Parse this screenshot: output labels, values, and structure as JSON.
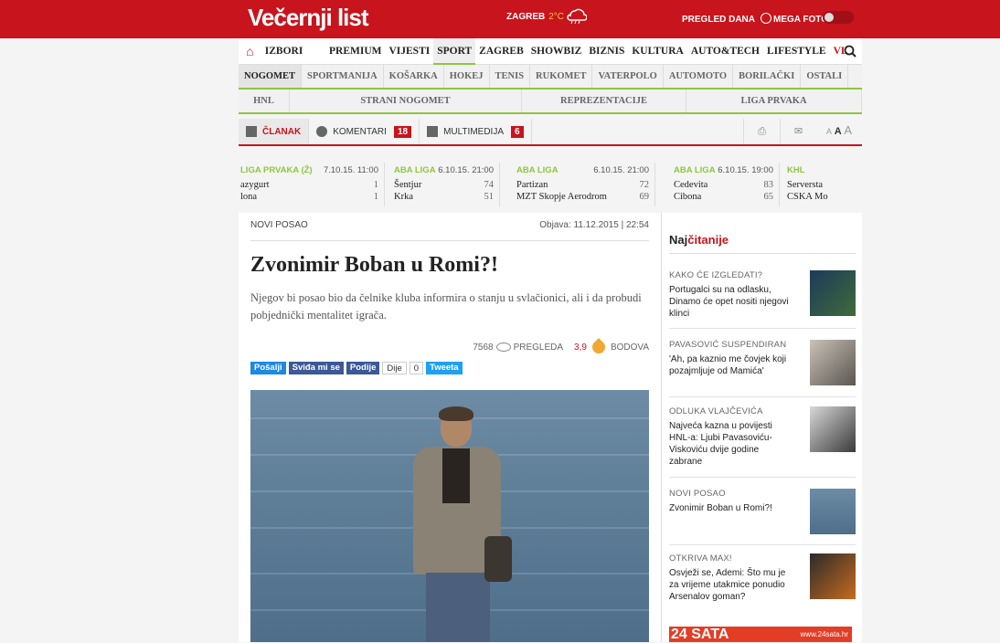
{
  "header": {
    "logo": "Večernji list",
    "weather_city": "ZAGREB",
    "weather_temp": "2°C",
    "pregled_label": "PREGLED DANA",
    "mega_label": "MEGA FOTO"
  },
  "mainnav": {
    "items": [
      "IZBORI 2015.",
      "PREMIUM",
      "VIJESTI",
      "SPORT",
      "ZAGREB",
      "SHOWBIZ",
      "BIZNIS",
      "KULTURA",
      "AUTO&TECH",
      "LIFESTYLE",
      "VL"
    ],
    "active": "SPORT"
  },
  "subnav": {
    "items": [
      "NOGOMET",
      "SPORTMANIJA",
      "KOŠARKA",
      "HOKEJ",
      "TENIS",
      "RUKOMET",
      "VATERPOLO",
      "AUTOMOTO",
      "BORILAČKI",
      "OSTALI"
    ],
    "active": "NOGOMET"
  },
  "subsub": {
    "items": [
      "HNL",
      "STRANI NOGOMET",
      "REPREZENTACIJE",
      "LIGA PRVAKA"
    ]
  },
  "tabs": {
    "clanak": "ČLANAK",
    "komentari": "KOMENTARI",
    "komentari_count": "18",
    "multimedija": "MULTIMEDIJA",
    "multimedija_count": "6",
    "font_small": "A",
    "font_mid": "A",
    "font_large": "A"
  },
  "scores": [
    {
      "league": "LIGA PRVAKA (Ž)",
      "date": "7.10.15. 11:00",
      "team1": "azygurt",
      "s1": "1",
      "team2": "lona",
      "s2": "1"
    },
    {
      "league": "ABA LIGA",
      "date": "6.10.15. 21:00",
      "team1": "Šentjur",
      "s1": "74",
      "team2": "Krka",
      "s2": "51"
    },
    {
      "league": "ABA LIGA",
      "date": "6.10.15. 21:00",
      "team1": "Partizan",
      "s1": "72",
      "team2": "MZT Skopje Aerodrom",
      "s2": "69"
    },
    {
      "league": "ABA LIGA",
      "date": "6.10.15. 19:00",
      "team1": "Cedevita",
      "s1": "83",
      "team2": "Cibona",
      "s2": "65"
    },
    {
      "league": "KHL",
      "date": "",
      "team1": "Serversta",
      "s1": "",
      "team2": "CSKA Mo",
      "s2": ""
    }
  ],
  "article": {
    "category": "NOVI POSAO",
    "published": "Objava: 11.12.2015 | 22:54",
    "title": "Zvonimir Boban u Romi?!",
    "lead": "Njegov bi posao bio da čelnike kluba informira o stanju u svlačionici, ali i da probudi pobjednički mentalitet igrača.",
    "views": "7568",
    "views_label": "PREGLEDA",
    "rating": "3,9",
    "rating_label": "BODOVA"
  },
  "share": {
    "messenger": "Pošalji",
    "fb_like": "Sviđa mi se",
    "fb_share": "Podije",
    "gplus": "Dije",
    "gplus_count": "0",
    "tweet": "Tweeta"
  },
  "sidebar": {
    "title_a": "Naj",
    "title_b": "čitanije",
    "items": [
      {
        "kicker": "KAKO ĆE IZGLEDATI?",
        "headline": "Portugalci su na odlasku, Dinamo će opet nositi njegovi klinci"
      },
      {
        "kicker": "PAVASOVIĆ SUSPENDIRAN",
        "headline": "'Ah, pa kaznio me čovjek koji pozajmljuje od Mamića'"
      },
      {
        "kicker": "ODLUKA VLAJČEVIĆA",
        "headline": "Najveća kazna u povijesti HNL-a: Ljubi Pavasoviću-Viskoviću dvije godine zabrane"
      },
      {
        "kicker": "NOVI POSAO",
        "headline": "Zvonimir Boban u Romi?!"
      },
      {
        "kicker": "OTKRIVA MAX!",
        "headline": "Osvježi se, Ademi: Što mu je za vrijeme utakmice ponudio Arsenalov goman?"
      }
    ],
    "ad_logo": "24 SATA",
    "ad_url": "www.24sata.hr"
  }
}
